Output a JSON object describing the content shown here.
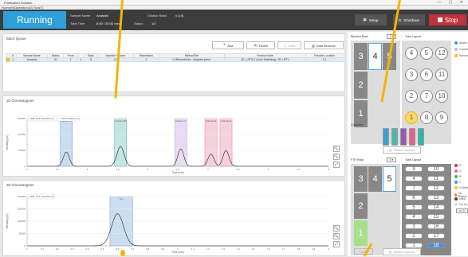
{
  "window": {
    "title": "Purification Solution",
    "menu": [
      "Home(H)",
      "Operation(O)",
      "Tool(T)"
    ]
  },
  "header": {
    "status": "Running",
    "sample_name_label": "Sample Name",
    "sample_name_value": "Analysis",
    "total_time_label": "Total Time",
    "total_time_value": "8:00 / 20:00 min",
    "status_label": "Status",
    "status_value": "1/2",
    "dilution_label": "Dilution Ratio",
    "dilution_value": "x1 [X]",
    "buttons": {
      "setup": "Setup",
      "shutdown": "Shutdown",
      "stop": "Stop"
    }
  },
  "batch": {
    "title": "Batch Queue",
    "buttons": {
      "add": "Add",
      "delete": "Delete",
      "clear": "Clear",
      "browser": "Data Browser"
    },
    "columns": [
      "",
      "#",
      "Sample Name",
      "Status",
      "From",
      "",
      "Rack",
      "Injection Volume",
      "Repetitions",
      "Method/Set",
      "Fraction Note",
      "Fraction Location"
    ],
    "rows": [
      [
        "",
        "1",
        "Analysis",
        "1D",
        "1",
        "1",
        "5",
        "0.1",
        "1",
        "C:\\ReserchDev - Analysis.pemo",
        "1D : UPTLC (Auto Switching), 2D: UPTL",
        "0.1"
      ]
    ]
  },
  "chrom1d": {
    "title": "1D Chromatogram",
    "legend": [
      "Ch1 UV(190 nm)",
      "Ch2 UV(254 nm)"
    ],
    "xlabel": "Time (min)",
    "ylabel": "Intensity (µV)"
  },
  "chrom2d": {
    "title": "2D Chromatogram",
    "legend": [
      "Ch1 UV(190 nm)"
    ],
    "xlabel": "Time (min)",
    "ylabel": "Intensity (µV)",
    "fraction_label": "0.1"
  },
  "chart_data": [
    {
      "type": "line",
      "title": "1D Chromatogram",
      "xlabel": "Time (min)",
      "ylabel": "Intensity (µV)",
      "xlim": [
        0,
        5
      ],
      "ylim": [
        0,
        150000
      ],
      "xticks": [
        "0",
        "0.5",
        "1",
        "1.5",
        "2",
        "2.5",
        "3",
        "3.5",
        "4",
        "4.5",
        "5"
      ],
      "yticks": [
        "0",
        "50000",
        "100000",
        "150000"
      ],
      "fractions": [
        {
          "label": "Column-A",
          "from": 0.55,
          "to": 0.75,
          "color": "#6a9fd8"
        },
        {
          "label": "Column-B",
          "from": 1.45,
          "to": 1.65,
          "color": "#4fb7a8"
        },
        {
          "label": "Column-C",
          "from": 2.45,
          "to": 2.65,
          "color": "#b99ad8"
        },
        {
          "label": "Column-D",
          "from": 2.95,
          "to": 3.15,
          "color": "#e47b9a"
        },
        {
          "label": "Column-E",
          "from": 3.2,
          "to": 3.4,
          "color": "#e47b9a"
        }
      ],
      "peaks": [
        {
          "x": 0.65,
          "h": 45000,
          "w": 0.05
        },
        {
          "x": 1.55,
          "h": 62000,
          "w": 0.06
        },
        {
          "x": 2.55,
          "h": 55000,
          "w": 0.05
        },
        {
          "x": 3.05,
          "h": 38000,
          "w": 0.05
        },
        {
          "x": 3.3,
          "h": 50000,
          "w": 0.05
        }
      ]
    },
    {
      "type": "line",
      "title": "2D Chromatogram",
      "xlabel": "Time (min)",
      "ylabel": "Intensity (µV)",
      "xlim": [
        0,
        2
      ],
      "ylim": [
        0,
        200000
      ],
      "xticks": [
        "0",
        "0.1",
        "0.2",
        "0.3",
        "0.4",
        "0.5",
        "0.6",
        "0.7",
        "0.8",
        "0.9",
        "1",
        "1.1",
        "1.2",
        "1.3",
        "1.4",
        "1.5",
        "1.6",
        "1.7",
        "1.8",
        "1.9",
        "2"
      ],
      "yticks": [
        "0",
        "50000",
        "100000",
        "150000",
        "200000"
      ],
      "fractions": [
        {
          "label": "0.1",
          "from": 0.55,
          "to": 0.7,
          "color": "#6a9fd8"
        }
      ],
      "peaks": [
        {
          "x": 0.6,
          "h": 130000,
          "w": 0.04
        }
      ]
    }
  ],
  "ejection_rack": {
    "label": "Ejection Rack",
    "dropdown": "1",
    "slots": [
      "3",
      "4",
      "5",
      "2",
      "1"
    ],
    "selected": "4"
  },
  "tube_layout": {
    "label": "Tube Layout",
    "vials": [
      "4",
      "5",
      "12",
      "3",
      "6",
      "11",
      "2",
      "7",
      "10",
      "1",
      "8",
      "9"
    ],
    "highlight": "1"
  },
  "legend_right": {
    "items": [
      "Added",
      "Completed",
      "Running"
    ],
    "colors": [
      "#4a90d9",
      "#bbbbbb",
      "#f5c400"
    ]
  },
  "columns_section": {
    "title": "Columns",
    "colors": [
      "#3aa0d8",
      "#4fb7a8",
      "#9b59b6",
      "#e4608a",
      "#2eb8a8"
    ],
    "button": "Station Opener"
  },
  "fth_rack": {
    "label": "FTH Rack",
    "dropdown": "5",
    "slots": [
      "3",
      "4",
      "5",
      "2",
      "1"
    ],
    "selected": "5",
    "open_button": "Open"
  },
  "tube_layout2": {
    "label": "Tube Layout",
    "rows": [
      [
        "9",
        "10"
      ],
      [
        "4",
        "11"
      ],
      [
        "7",
        "12"
      ],
      [
        "6",
        "13"
      ],
      [
        "5",
        "14"
      ],
      [
        "4",
        "15"
      ],
      [
        "3",
        "16"
      ],
      [
        "2",
        "17"
      ],
      [
        "1",
        "18"
      ]
    ],
    "button": "Station Opener"
  },
  "legend_right2": {
    "items": [
      "R",
      "G",
      "B",
      "C",
      "Collection",
      "1D Region",
      "Used",
      "For Inj."
    ],
    "colors": [
      "#e0303a",
      "#e06a90",
      "#2eb85c",
      "#3aa0d8",
      "#f5c400",
      "#f58a00",
      "#444444",
      "#dddddd"
    ],
    "unit": "mL/10"
  }
}
